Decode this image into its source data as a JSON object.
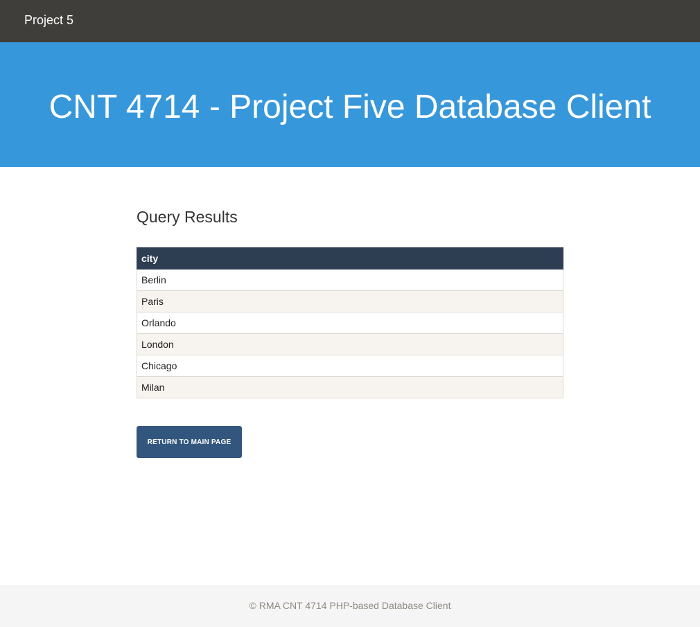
{
  "navbar": {
    "brand": "Project 5",
    "background": "#403e3a"
  },
  "hero": {
    "title": "CNT 4714 - Project Five Database Client",
    "background": "#3797db"
  },
  "main": {
    "heading": "Query Results",
    "table": {
      "columns": [
        "city"
      ],
      "rows": [
        [
          "Berlin"
        ],
        [
          "Paris"
        ],
        [
          "Orlando"
        ],
        [
          "London"
        ],
        [
          "Chicago"
        ],
        [
          "Milan"
        ]
      ],
      "header_color": "#2e3e52",
      "stripe_color": "#f7f3ee"
    },
    "return_button_label": "RETURN TO MAIN PAGE",
    "button_color": "#33567e"
  },
  "footer": {
    "text": "© RMA CNT 4714 PHP-based Database Client"
  }
}
